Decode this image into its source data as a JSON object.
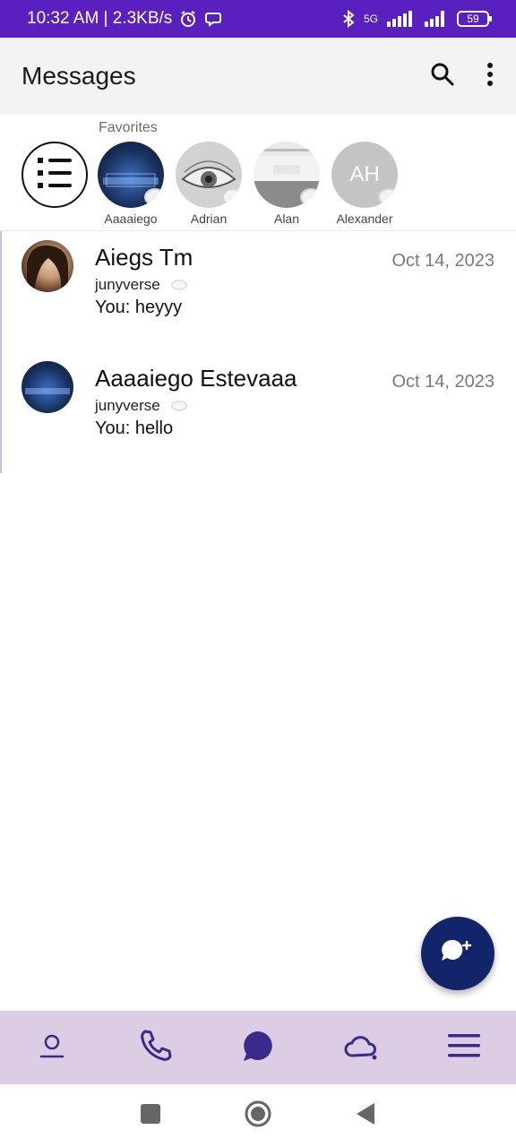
{
  "status_bar": {
    "time_and_speed": "10:32 AM | 2.3KB/s",
    "network": "5G",
    "battery_level": "59",
    "bg_color": "#5a1fbf"
  },
  "app_bar": {
    "title": "Messages",
    "search_icon": "search-icon",
    "more_icon": "more-vert-icon"
  },
  "favorites": {
    "label": "Favorites",
    "items": [
      {
        "name": "Aaaaiego",
        "avatar": "game-cover"
      },
      {
        "name": "Adrian",
        "avatar": "eye-sketch"
      },
      {
        "name": "Alan",
        "avatar": "dialog-screenshot"
      },
      {
        "name": "Alexander",
        "avatar": "initials",
        "initials": "AH"
      }
    ]
  },
  "chats": [
    {
      "name": "Aiegs Tm",
      "account": "junyverse",
      "preview": "You: heyyy",
      "date": "Oct 14, 2023"
    },
    {
      "name": "Aaaaiego Estevaaa",
      "account": "junyverse",
      "preview": "You: hello",
      "date": "Oct 14, 2023"
    }
  ],
  "fab": {
    "icon": "new-chat-icon",
    "color": "#12256a"
  },
  "bottom_nav": {
    "items": [
      "profile-icon",
      "phone-icon",
      "chat-icon",
      "cloud-icon",
      "menu-icon"
    ],
    "bg_color": "#dccde4",
    "accent_color": "#3a2a8a"
  },
  "system_nav": [
    "recents-icon",
    "home-icon",
    "back-icon"
  ]
}
